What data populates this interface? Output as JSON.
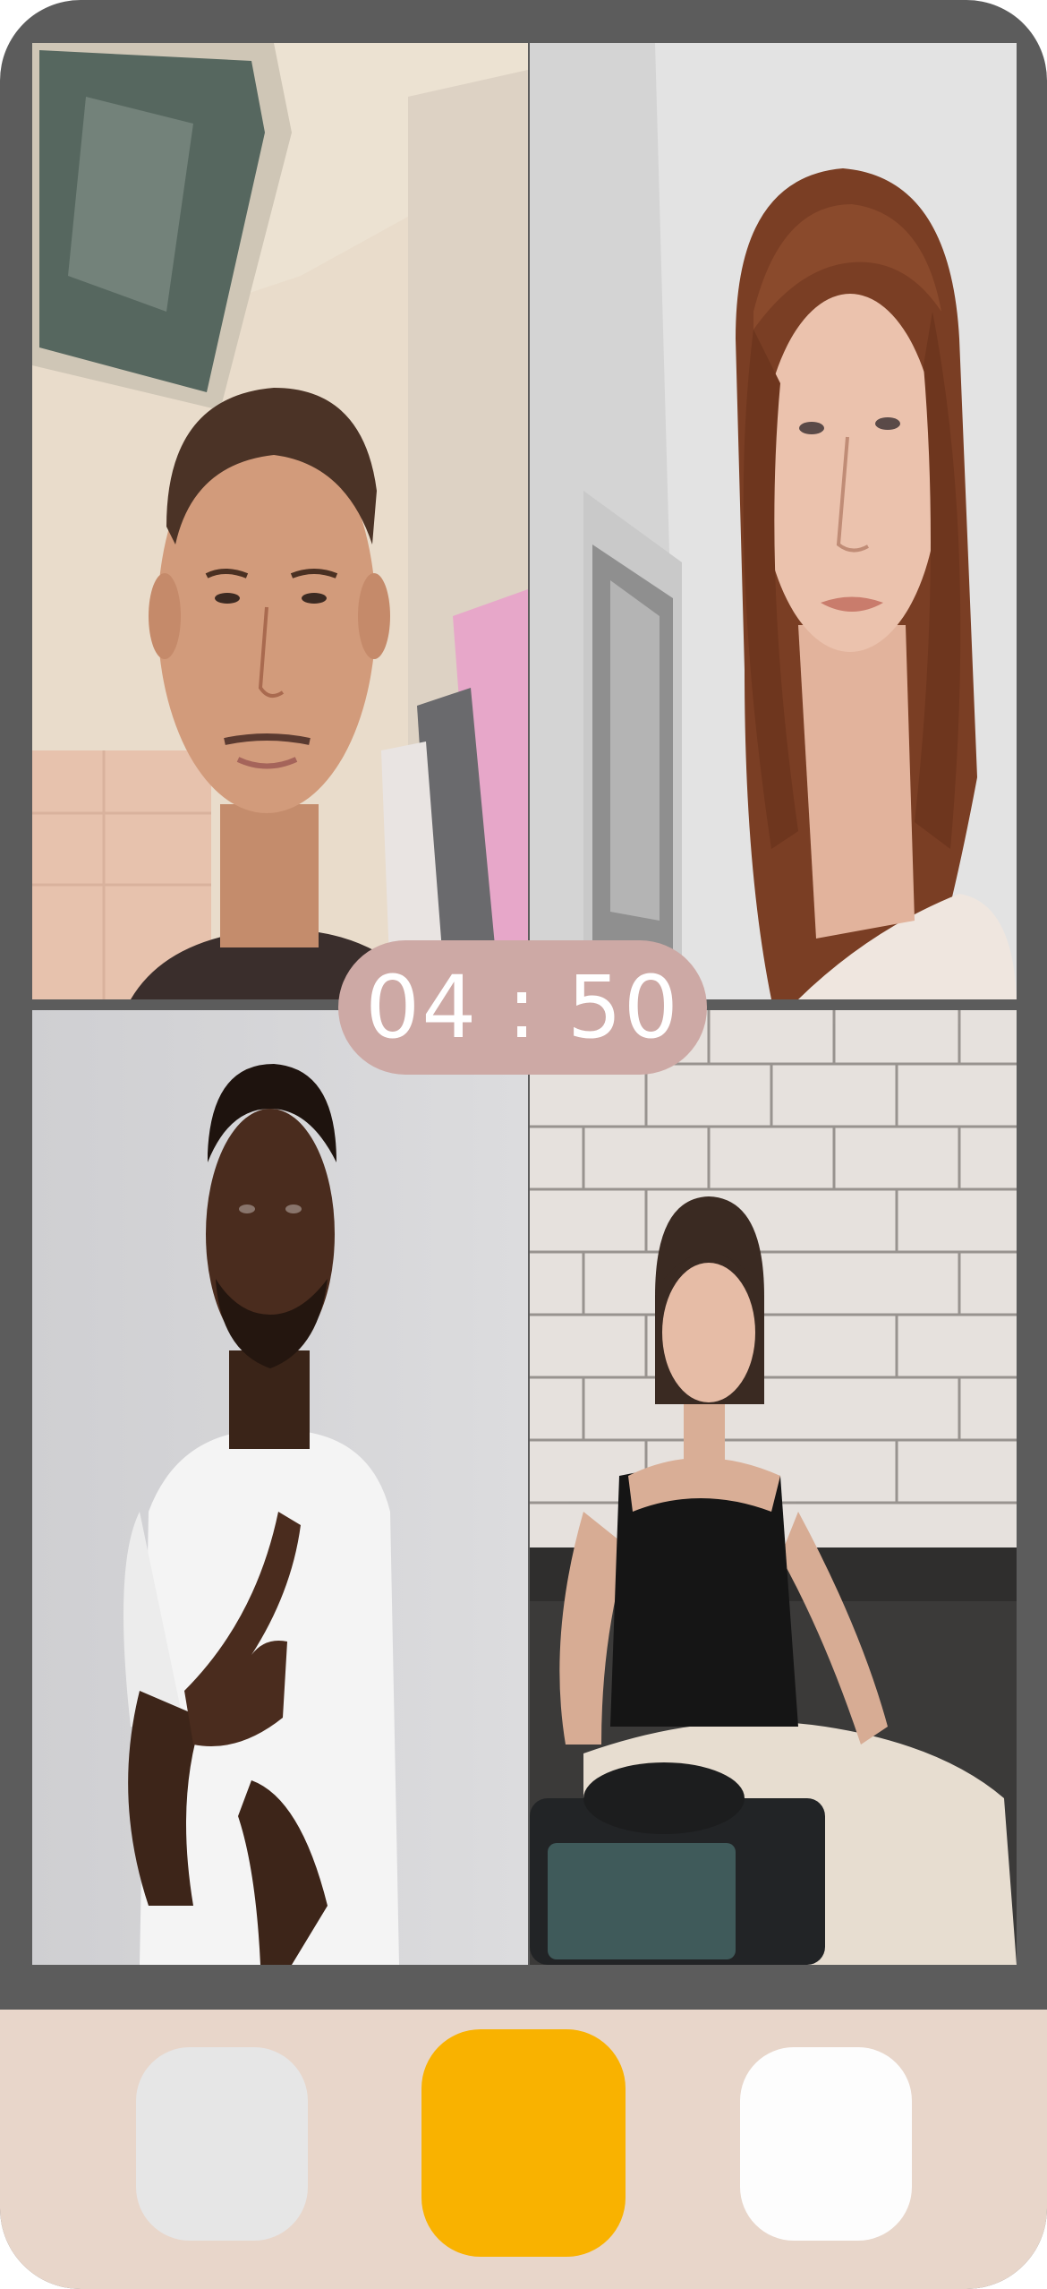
{
  "call": {
    "timer": "04 : 50"
  },
  "participants": [
    {
      "tile": "participant-1",
      "description_icon": "person-video-feed"
    },
    {
      "tile": "participant-2",
      "description_icon": "person-video-feed"
    },
    {
      "tile": "participant-3",
      "description_icon": "person-video-feed"
    },
    {
      "tile": "participant-4",
      "description_icon": "person-video-feed"
    }
  ],
  "controls": {
    "colors": {
      "left": "#e6e6e6",
      "middle": "#f9b200",
      "right": "#fdfdfd",
      "bar": "#e8d6ca"
    }
  },
  "colors": {
    "frame": "#5c5c5c",
    "timer_bg": "#cda9a5"
  }
}
